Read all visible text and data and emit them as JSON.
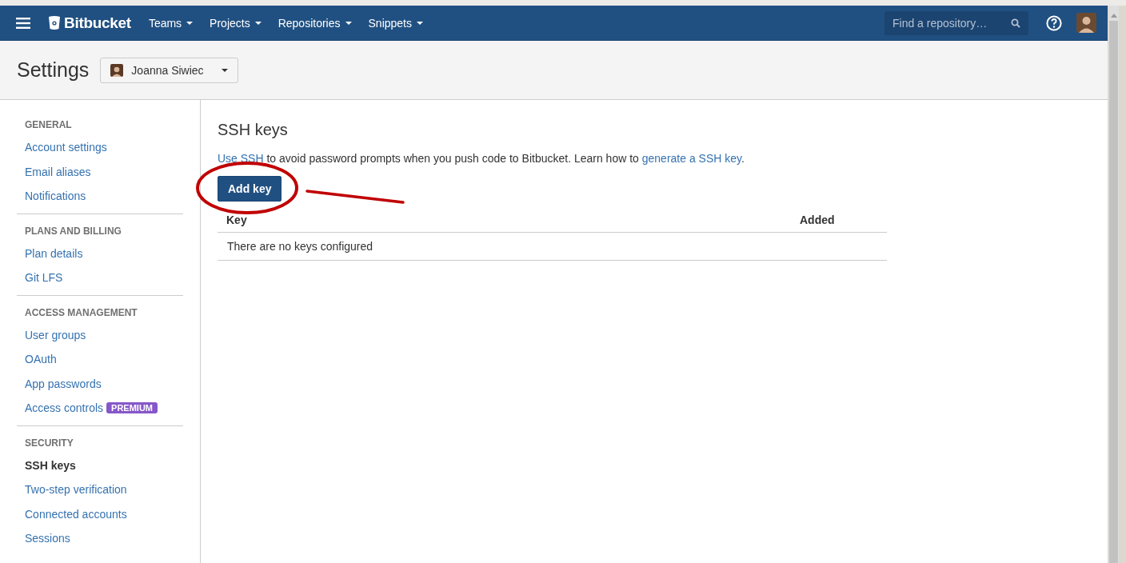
{
  "nav": {
    "logo": "Bitbucket",
    "menus": [
      {
        "label": "Teams"
      },
      {
        "label": "Projects"
      },
      {
        "label": "Repositories"
      },
      {
        "label": "Snippets"
      }
    ],
    "search": {
      "placeholder": "Find a repository…"
    }
  },
  "header": {
    "title": "Settings",
    "account": "Joanna Siwiec"
  },
  "sidebar": {
    "sections": [
      {
        "heading": "GENERAL",
        "items": [
          {
            "label": "Account settings",
            "selected": false
          },
          {
            "label": "Email aliases",
            "selected": false
          },
          {
            "label": "Notifications",
            "selected": false
          }
        ]
      },
      {
        "heading": "PLANS AND BILLING",
        "items": [
          {
            "label": "Plan details",
            "selected": false
          },
          {
            "label": "Git LFS",
            "selected": false
          }
        ]
      },
      {
        "heading": "ACCESS MANAGEMENT",
        "items": [
          {
            "label": "User groups",
            "selected": false
          },
          {
            "label": "OAuth",
            "selected": false
          },
          {
            "label": "App passwords",
            "selected": false
          },
          {
            "label": "Access controls",
            "selected": false,
            "badge": "PREMIUM"
          }
        ]
      },
      {
        "heading": "SECURITY",
        "items": [
          {
            "label": "SSH keys",
            "selected": true
          },
          {
            "label": "Two-step verification",
            "selected": false
          },
          {
            "label": "Connected accounts",
            "selected": false
          },
          {
            "label": "Sessions",
            "selected": false
          }
        ]
      }
    ]
  },
  "content": {
    "title": "SSH keys",
    "description": [
      {
        "kind": "link",
        "text": "Use SSH"
      },
      {
        "kind": "text",
        "text": " to avoid password prompts when you push code to Bitbucket. Learn how to "
      },
      {
        "kind": "link",
        "text": "generate a SSH key"
      },
      {
        "kind": "text",
        "text": "."
      }
    ],
    "button": "Add key",
    "table": {
      "columns": [
        "Key",
        "Added"
      ],
      "empty": "There are no keys configured"
    }
  }
}
